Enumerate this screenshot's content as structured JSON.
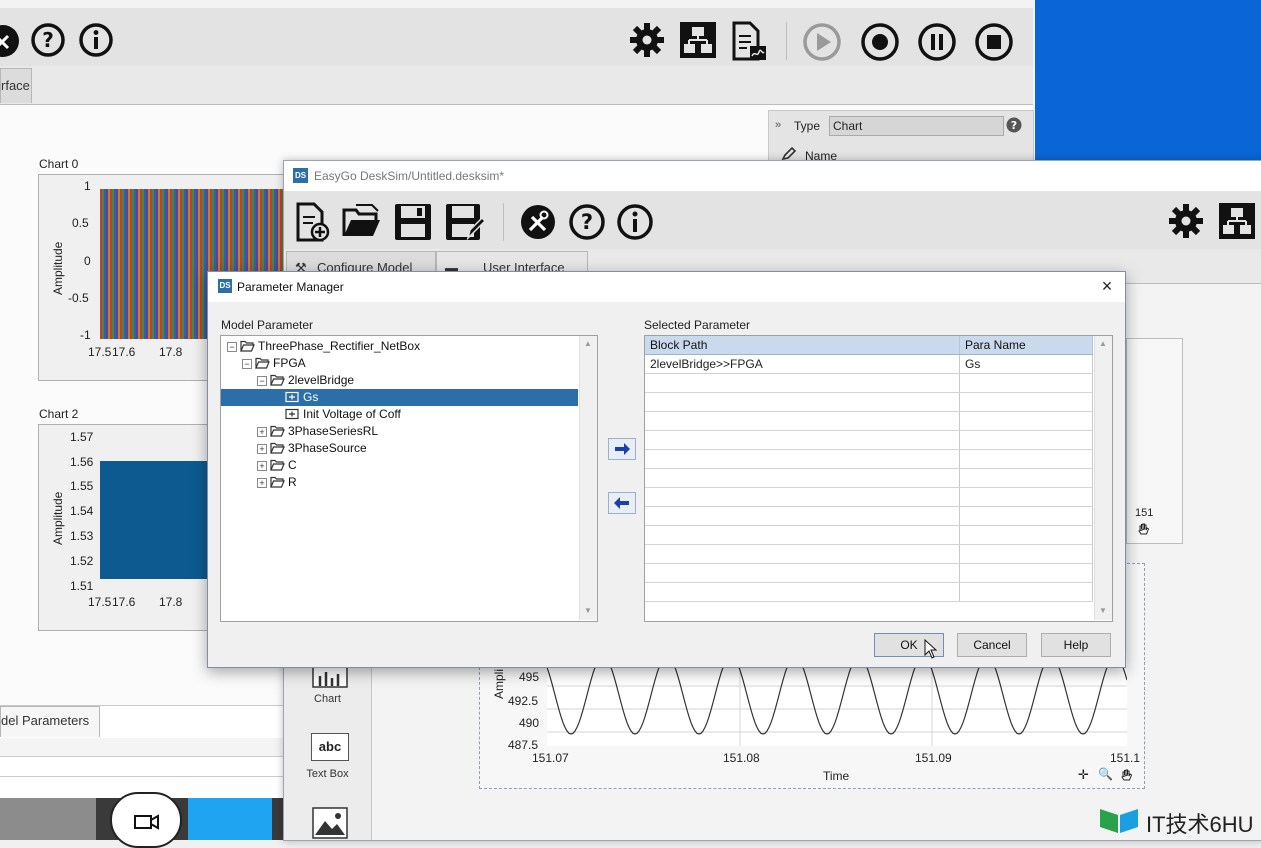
{
  "background_window": {
    "tab_partial": "rface",
    "chart0": {
      "title": "Chart 0",
      "ylabel": "Amplitude",
      "yticks": [
        "1",
        "0.5",
        "0",
        "-0.5",
        "-1"
      ],
      "xticks": [
        "17.5",
        "17.6",
        "17.8"
      ]
    },
    "chart2": {
      "title": "Chart 2",
      "ylabel": "Amplitude",
      "yticks": [
        "1.57",
        "1.56",
        "1.55",
        "1.54",
        "1.53",
        "1.52",
        "1.51"
      ],
      "xticks": [
        "17.5",
        "17.6",
        "17.8"
      ]
    },
    "bottom_tab": "del Parameters",
    "type_panel": {
      "label": "Type",
      "value": "Chart",
      "name_label": "Name"
    }
  },
  "second_window": {
    "title": "EasyGo DeskSim/Untitled.desksim*",
    "tabs": [
      "Configure Model",
      "User Interface"
    ],
    "palette": [
      {
        "label": "Chart"
      },
      {
        "label": "Text Box"
      }
    ],
    "chart": {
      "ylabel": "Ampli",
      "xlabel": "Time",
      "yticks": [
        "495",
        "492.5",
        "490",
        "487.5"
      ],
      "xticks": [
        "151.07",
        "151.08",
        "151.09",
        "151.1"
      ],
      "right_tick": "151"
    }
  },
  "dialog": {
    "title": "Parameter Manager",
    "left_title": "Model Parameter",
    "right_title": "Selected Parameter",
    "tree": [
      {
        "label": "ThreePhase_Rectifier_NetBox",
        "depth": 0,
        "kind": "folder",
        "exp": "minus"
      },
      {
        "label": "FPGA",
        "depth": 1,
        "kind": "folder",
        "exp": "minus"
      },
      {
        "label": "2levelBridge",
        "depth": 2,
        "kind": "folder",
        "exp": "minus"
      },
      {
        "label": "Gs",
        "depth": 3,
        "kind": "param",
        "exp": "",
        "selected": true
      },
      {
        "label": "Init Voltage of Coff",
        "depth": 3,
        "kind": "param",
        "exp": ""
      },
      {
        "label": "3PhaseSeriesRL",
        "depth": 2,
        "kind": "folder",
        "exp": "plus"
      },
      {
        "label": "3PhaseSource",
        "depth": 2,
        "kind": "folder",
        "exp": "plus"
      },
      {
        "label": "C",
        "depth": 2,
        "kind": "folder",
        "exp": "plus"
      },
      {
        "label": "R",
        "depth": 2,
        "kind": "folder",
        "exp": "plus"
      }
    ],
    "columns": [
      "Block Path",
      "Para Name"
    ],
    "rows": [
      [
        "2levelBridge>>FPGA",
        "Gs"
      ]
    ],
    "buttons": {
      "ok": "OK",
      "cancel": "Cancel",
      "help": "Help"
    },
    "close": "×"
  },
  "watermark": "IT技术6HU",
  "colors": {
    "selection": "#2b6ea8",
    "accent_blue": "#0a66d6",
    "header": "#c9daef"
  }
}
